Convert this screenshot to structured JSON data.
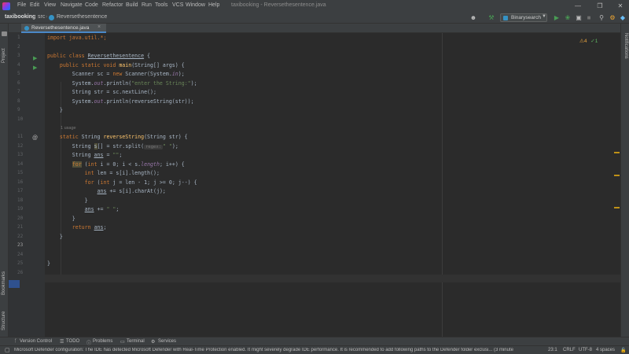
{
  "menu": [
    "File",
    "Edit",
    "View",
    "Navigate",
    "Code",
    "Refactor",
    "Build",
    "Run",
    "Tools",
    "VCS",
    "Window",
    "Help"
  ],
  "window_title": "taxibooking - Reversethesentence.java",
  "breadcrumbs": [
    "taxibooking",
    "src",
    "Reversethesentence"
  ],
  "run_config": "Binarysearch",
  "tab": {
    "label": "Reversethesentence.java",
    "close": "×"
  },
  "left_strip": {
    "project": "Project",
    "bookmarks": "Bookmarks",
    "structure": "Structure"
  },
  "right_strip": {
    "notifications": "Notifications"
  },
  "inspection": {
    "warnings": "⚠4",
    "ok": "✓1"
  },
  "code": {
    "line_numbers": [
      "1",
      "2",
      "3",
      "4",
      "5",
      "6",
      "7",
      "8",
      "9",
      "10",
      "11",
      "12",
      "13",
      "14",
      "15",
      "16",
      "17",
      "18",
      "19",
      "20",
      "21",
      "22",
      "23",
      "24",
      "25",
      "26"
    ],
    "usage_hint": "1 usage",
    "regex_hint": "regex:",
    "lines": {
      "l1": "import java.util.*;",
      "l3a": "public class ",
      "l3b": "Reversethesentence",
      "l3c": " {",
      "l4a": "    public static void ",
      "l4b": "main",
      "l4c": "(String[] args) {",
      "l5a": "        Scanner sc = ",
      "l5b": "new",
      "l5c": " Scanner(System.",
      "l5d": "in",
      "l5e": ");",
      "l6a": "        System.",
      "l6b": "out",
      "l6c": ".println(",
      "l6d": "\"enter the String:\"",
      "l6e": ");",
      "l7": "        String str = sc.nextLine();",
      "l8a": "        System.",
      "l8b": "out",
      "l8c": ".println(reverseString(str));",
      "l9": "    }",
      "l11a": "    static ",
      "l11b": "String ",
      "l11c": "reverseString",
      "l11d": "(String str) {",
      "l12a": "        String ",
      "l12b": "s",
      "l12c": "[] = str.split(",
      "l12d": "\" \"",
      "l12e": ");",
      "l13a": "        String ",
      "l13b": "ans",
      "l13c": " = ",
      "l13d": "\"\"",
      "l13e": ";",
      "l14a": "        ",
      "l14b": "for",
      "l14c": " (",
      "l14d": "int",
      "l14e": " i = 0; i < s.",
      "l14f": "length",
      "l14g": "; i++) {",
      "l15a": "            ",
      "l15b": "int",
      "l15c": " len = s[i].length();",
      "l16a": "            ",
      "l16b": "for",
      "l16c": " (",
      "l16d": "int",
      "l16e": " j = len - 1; j >= 0; j--) {",
      "l17a": "                ",
      "l17b": "ans",
      "l17c": " += s[i].charAt(j);",
      "l18": "            }",
      "l19a": "            ",
      "l19b": "ans",
      "l19c": " += ",
      "l19d": "\" \"",
      "l19e": ";",
      "l20": "        }",
      "l21a": "        ",
      "l21b": "return",
      "l21c": " ",
      "l21d": "ans",
      "l21e": ";",
      "l22": "    }",
      "l25": "}"
    }
  },
  "bottom_tools": [
    "Version Control",
    "TODO",
    "Problems",
    "Terminal",
    "Services"
  ],
  "status": {
    "message": "Microsoft Defender configuration: The IDE has detected Microsoft Defender with Real-Time Protection enabled. It might severely degrade IDE performance. It is recommended to add following paths to the Defender folder exclusi... (3 minute",
    "position": "23:1",
    "line_sep": "CRLF",
    "encoding": "UTF-8",
    "indent": "4 spaces"
  },
  "colors": {
    "accent": "#4a88c7",
    "keyword": "#cc7832",
    "string": "#6a8759",
    "method": "#ffc66d",
    "field": "#9876aa",
    "run_green": "#499c54"
  },
  "icons": [
    "intellij-logo-icon",
    "java-class-icon",
    "run-icon",
    "debug-icon",
    "stop-icon",
    "search-icon",
    "settings-icon",
    "hammer-icon",
    "user-icon",
    "override-icon",
    "problems-icon",
    "terminal-icon",
    "services-icon",
    "vcs-icon",
    "todo-icon"
  ]
}
